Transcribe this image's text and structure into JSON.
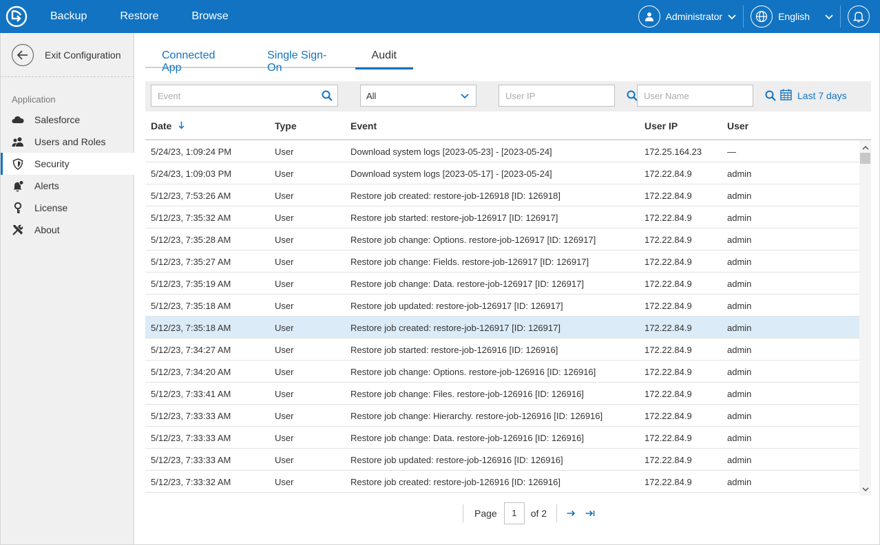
{
  "topbar": {
    "nav": [
      "Backup",
      "Restore",
      "Browse"
    ],
    "user_label": "Administrator",
    "language_label": "English"
  },
  "sidebar": {
    "exit_label": "Exit Configuration",
    "section_title": "Application",
    "items": [
      {
        "label": "Salesforce",
        "icon": "cloud-icon"
      },
      {
        "label": "Users and Roles",
        "icon": "users-icon"
      },
      {
        "label": "Security",
        "icon": "shield-icon"
      },
      {
        "label": "Alerts",
        "icon": "bell-icon"
      },
      {
        "label": "License",
        "icon": "key-icon"
      },
      {
        "label": "About",
        "icon": "tools-icon"
      }
    ],
    "active": "Security"
  },
  "tabs": [
    "Connected App",
    "Single Sign-On",
    "Audit"
  ],
  "active_tab": "Audit",
  "filters": {
    "event_placeholder": "Event",
    "type_value": "All",
    "ip_placeholder": "User IP",
    "user_placeholder": "User Name",
    "date_range": "Last 7 days"
  },
  "table": {
    "columns": [
      "Date",
      "Type",
      "Event",
      "User IP",
      "User"
    ],
    "sort_icon": "arrow-down-icon",
    "rows": [
      {
        "date": "5/24/23, 1:09:24 PM",
        "type": "User",
        "event": "Download system logs [2023-05-23] - [2023-05-24]",
        "ip": "172.25.164.23",
        "user": "—"
      },
      {
        "date": "5/24/23, 1:09:03 PM",
        "type": "User",
        "event": "Download system logs [2023-05-17] - [2023-05-24]",
        "ip": "172.22.84.9",
        "user": "admin"
      },
      {
        "date": "5/12/23, 7:53:26 AM",
        "type": "User",
        "event": "Restore job created: restore-job-126918 [ID: 126918]",
        "ip": "172.22.84.9",
        "user": "admin"
      },
      {
        "date": "5/12/23, 7:35:32 AM",
        "type": "User",
        "event": "Restore job started: restore-job-126917 [ID: 126917]",
        "ip": "172.22.84.9",
        "user": "admin"
      },
      {
        "date": "5/12/23, 7:35:28 AM",
        "type": "User",
        "event": "Restore job change: Options. restore-job-126917 [ID: 126917]",
        "ip": "172.22.84.9",
        "user": "admin"
      },
      {
        "date": "5/12/23, 7:35:27 AM",
        "type": "User",
        "event": "Restore job change: Fields. restore-job-126917 [ID: 126917]",
        "ip": "172.22.84.9",
        "user": "admin"
      },
      {
        "date": "5/12/23, 7:35:19 AM",
        "type": "User",
        "event": "Restore job change: Data. restore-job-126917 [ID: 126917]",
        "ip": "172.22.84.9",
        "user": "admin"
      },
      {
        "date": "5/12/23, 7:35:18 AM",
        "type": "User",
        "event": "Restore job updated: restore-job-126917 [ID: 126917]",
        "ip": "172.22.84.9",
        "user": "admin"
      },
      {
        "date": "5/12/23, 7:35:18 AM",
        "type": "User",
        "event": "Restore job created: restore-job-126917 [ID: 126917]",
        "ip": "172.22.84.9",
        "user": "admin",
        "selected": true
      },
      {
        "date": "5/12/23, 7:34:27 AM",
        "type": "User",
        "event": "Restore job started: restore-job-126916 [ID: 126916]",
        "ip": "172.22.84.9",
        "user": "admin"
      },
      {
        "date": "5/12/23, 7:34:20 AM",
        "type": "User",
        "event": "Restore job change: Options. restore-job-126916 [ID: 126916]",
        "ip": "172.22.84.9",
        "user": "admin"
      },
      {
        "date": "5/12/23, 7:33:41 AM",
        "type": "User",
        "event": "Restore job change: Files. restore-job-126916 [ID: 126916]",
        "ip": "172.22.84.9",
        "user": "admin"
      },
      {
        "date": "5/12/23, 7:33:33 AM",
        "type": "User",
        "event": "Restore job change: Hierarchy. restore-job-126916 [ID: 126916]",
        "ip": "172.22.84.9",
        "user": "admin"
      },
      {
        "date": "5/12/23, 7:33:33 AM",
        "type": "User",
        "event": "Restore job change: Data. restore-job-126916 [ID: 126916]",
        "ip": "172.22.84.9",
        "user": "admin"
      },
      {
        "date": "5/12/23, 7:33:33 AM",
        "type": "User",
        "event": "Restore job updated: restore-job-126916 [ID: 126916]",
        "ip": "172.22.84.9",
        "user": "admin"
      },
      {
        "date": "5/12/23, 7:33:32 AM",
        "type": "User",
        "event": "Restore job created: restore-job-126916 [ID: 126916]",
        "ip": "172.22.84.9",
        "user": "admin"
      }
    ]
  },
  "pager": {
    "page_label": "Page",
    "page_value": "1",
    "of_label": "of 2"
  },
  "colors": {
    "brand": "#1173c2",
    "selected_row": "#dcebf8"
  }
}
